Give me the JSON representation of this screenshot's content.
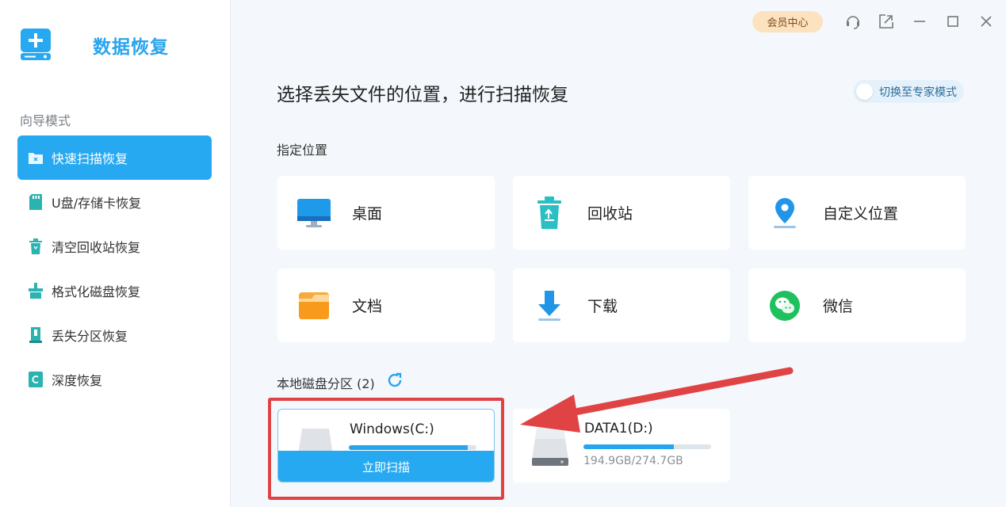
{
  "app": {
    "title": "数据恢复"
  },
  "sidebar": {
    "section_label": "向导模式",
    "items": [
      {
        "label": "快速扫描恢复",
        "icon": "folder-scan-icon",
        "active": true
      },
      {
        "label": "U盘/存储卡恢复",
        "icon": "sd-card-icon",
        "active": false
      },
      {
        "label": "清空回收站恢复",
        "icon": "recycle-bin-icon",
        "active": false
      },
      {
        "label": "格式化磁盘恢复",
        "icon": "format-disk-icon",
        "active": false
      },
      {
        "label": "丢失分区恢复",
        "icon": "partition-icon",
        "active": false
      },
      {
        "label": "深度恢复",
        "icon": "deep-scan-icon",
        "active": false
      }
    ]
  },
  "topbar": {
    "vip_label": "会员中心",
    "icons": [
      "support-headset-icon",
      "share-icon",
      "minimize-icon",
      "maximize-icon",
      "close-icon"
    ]
  },
  "main": {
    "title": "选择丢失文件的位置，进行扫描恢复",
    "expert_mode_label": "切换至专家模式",
    "locations_label": "指定位置",
    "locations": [
      {
        "label": "桌面",
        "icon": "desktop-monitor-icon"
      },
      {
        "label": "回收站",
        "icon": "recycle-bin-icon"
      },
      {
        "label": "自定义位置",
        "icon": "location-pin-icon"
      },
      {
        "label": "文档",
        "icon": "folder-icon"
      },
      {
        "label": "下载",
        "icon": "download-icon"
      },
      {
        "label": "微信",
        "icon": "wechat-icon"
      }
    ],
    "drives_label": "本地磁盘分区 (2)",
    "drives": [
      {
        "name": "Windows(C:)",
        "used_fraction": 0.93,
        "size": "",
        "scan_label": "立即扫描",
        "hovered": true
      },
      {
        "name": "DATA1(D:)",
        "used_fraction": 0.71,
        "size": "194.9GB/274.7GB",
        "hovered": false
      }
    ]
  },
  "colors": {
    "accent": "#27a9f1",
    "vip_bg": "#fde2bf",
    "annotation_red": "#e04344"
  }
}
